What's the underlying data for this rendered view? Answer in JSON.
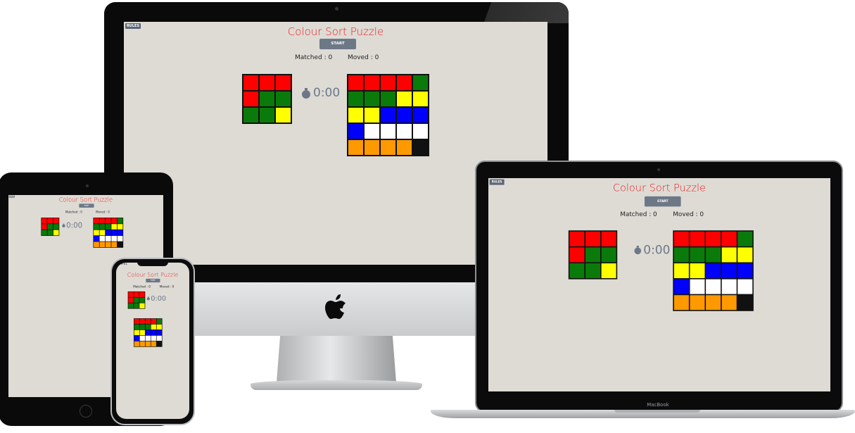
{
  "game": {
    "rules_label": "RULES",
    "title": "Colour Sort Puzzle",
    "start_label": "START",
    "matched_label": "Matched : 0",
    "moved_label": "Moved : 0",
    "timer": "0:00",
    "target_grid": [
      "red",
      "red",
      "red",
      "red",
      "green",
      "green",
      "green",
      "green",
      "yellow"
    ],
    "play_grid": [
      "red",
      "red",
      "red",
      "red",
      "green",
      "green",
      "green",
      "green",
      "yellow",
      "yellow",
      "yellow",
      "yellow",
      "blue",
      "blue",
      "blue",
      "blue",
      "white",
      "white",
      "white",
      "white",
      "orange",
      "orange",
      "orange",
      "orange",
      "empty"
    ]
  },
  "colors": {
    "red": "#ff0000",
    "green": "#0a7a0a",
    "yellow": "#ffff00",
    "blue": "#0000ff",
    "white": "#ffffff",
    "orange": "#ff9900",
    "empty": "#111111",
    "title": "#e8211f",
    "button": "#6d7887"
  },
  "devices": {
    "macbook_label": "MacBook",
    "iphone_time": "9:41"
  }
}
